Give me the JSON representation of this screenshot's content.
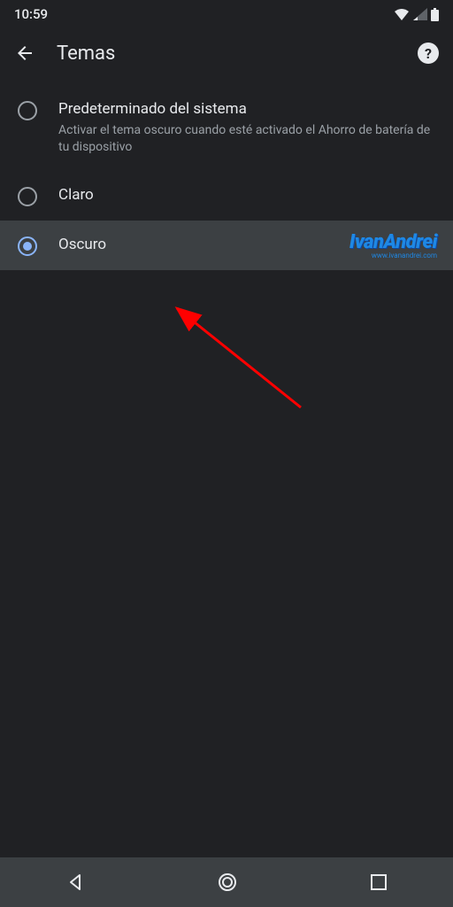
{
  "status": {
    "time": "10:59"
  },
  "header": {
    "title": "Temas"
  },
  "options": [
    {
      "title": "Predeterminado del sistema",
      "subtitle": "Activar el tema oscuro cuando esté activado el Ahorro de batería de tu dispositivo",
      "selected": false
    },
    {
      "title": "Claro",
      "subtitle": "",
      "selected": false
    },
    {
      "title": "Oscuro",
      "subtitle": "",
      "selected": true
    }
  ],
  "watermark": {
    "main": "IvanAndrei",
    "sub": "www.ivanandrei.com"
  }
}
